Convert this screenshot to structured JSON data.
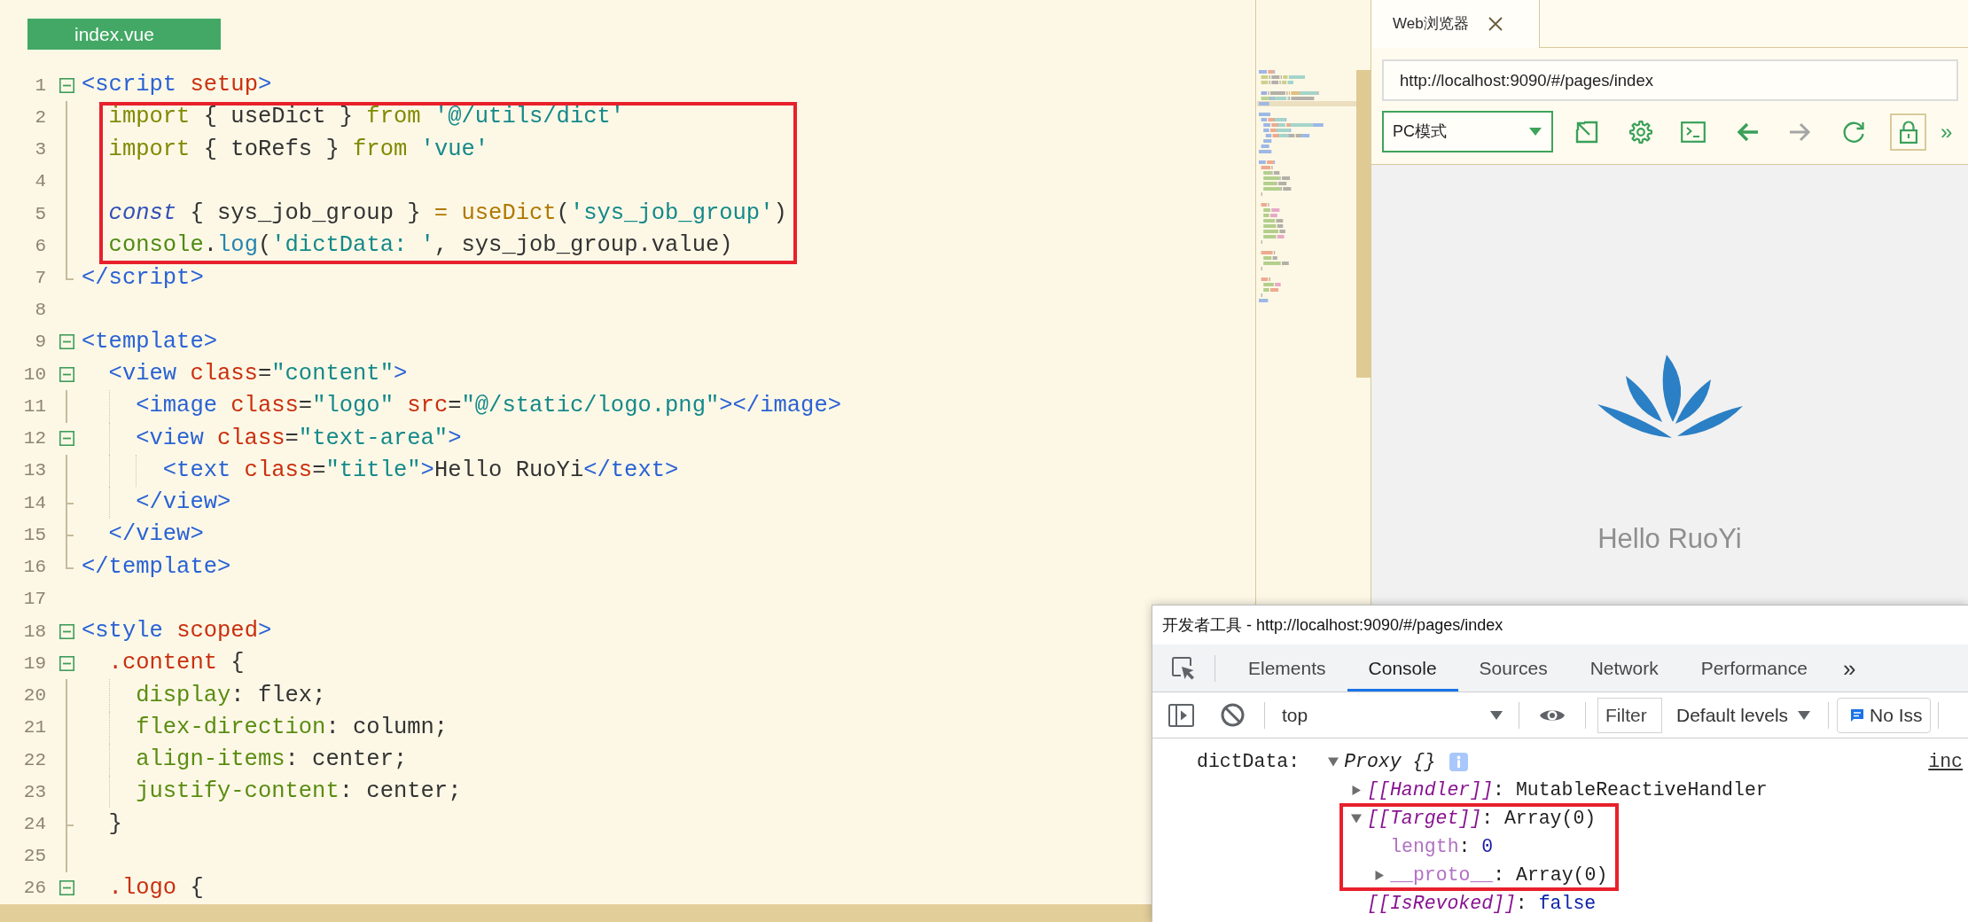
{
  "editor": {
    "tab": {
      "label": "index.vue",
      "selected": true
    },
    "lines": [
      {
        "number": "1",
        "kind": "fold",
        "boxed": false,
        "tokens": [
          {
            "text": "<script",
            "kind": "tag"
          },
          {
            "text": " setup",
            "kind": "attr"
          },
          {
            "text": ">",
            "kind": "tag"
          }
        ]
      },
      {
        "number": "2",
        "kind": "bar",
        "boxed": true,
        "tokens": [
          {
            "text": "  import",
            "kind": "keyword"
          },
          {
            "text": " { useDict } ",
            "kind": "plain"
          },
          {
            "text": "from",
            "kind": "keyword"
          },
          {
            "text": " '@/utils/dict'",
            "kind": "string"
          }
        ]
      },
      {
        "number": "3",
        "kind": "bar",
        "boxed": true,
        "tokens": [
          {
            "text": "  import",
            "kind": "keyword"
          },
          {
            "text": " { toRefs } ",
            "kind": "plain"
          },
          {
            "text": "from",
            "kind": "keyword"
          },
          {
            "text": " 'vue'",
            "kind": "string"
          }
        ]
      },
      {
        "number": "4",
        "kind": "bar",
        "boxed": true
      },
      {
        "number": "5",
        "kind": "bar",
        "boxed": true,
        "tokens": [
          {
            "text": "  const",
            "kind": "const"
          },
          {
            "text": " { sys_job_group } ",
            "kind": "plain"
          },
          {
            "text": "=",
            "kind": "operator"
          },
          {
            "text": " useDict",
            "kind": "func"
          },
          {
            "text": "(",
            "kind": "plain"
          },
          {
            "text": "'sys_job_group'",
            "kind": "string"
          },
          {
            "text": ")",
            "kind": "plain"
          }
        ]
      },
      {
        "number": "6",
        "kind": "bar",
        "boxed": true,
        "tokens": [
          {
            "text": "  console",
            "kind": "global"
          },
          {
            "text": ".",
            "kind": "plain"
          },
          {
            "text": "log",
            "kind": "method"
          },
          {
            "text": "(",
            "kind": "plain"
          },
          {
            "text": "'dictData: '",
            "kind": "string"
          },
          {
            "text": ", sys_job_group.value)",
            "kind": "plain"
          }
        ]
      },
      {
        "number": "7",
        "kind": "end",
        "boxed": false,
        "tokens": [
          {
            "text": "</script>",
            "kind": "tag"
          }
        ]
      },
      {
        "number": "8",
        "kind": "none",
        "boxed": false
      },
      {
        "number": "9",
        "kind": "fold",
        "boxed": false,
        "tokens": [
          {
            "text": "<template>",
            "kind": "tag"
          }
        ]
      },
      {
        "number": "10",
        "kind": "fold",
        "boxed": false,
        "tokens": [
          {
            "text": "  <view",
            "kind": "tag"
          },
          {
            "text": " class",
            "kind": "attr"
          },
          {
            "text": "=",
            "kind": "plain"
          },
          {
            "text": "\"content\"",
            "kind": "string"
          },
          {
            "text": ">",
            "kind": "tag"
          }
        ]
      },
      {
        "number": "11",
        "kind": "bar",
        "boxed": false,
        "tokens": [
          {
            "text": "    <image",
            "kind": "tag"
          },
          {
            "text": " class",
            "kind": "attr"
          },
          {
            "text": "=",
            "kind": "plain"
          },
          {
            "text": "\"logo\"",
            "kind": "string"
          },
          {
            "text": " src",
            "kind": "attr"
          },
          {
            "text": "=",
            "kind": "plain"
          },
          {
            "text": "\"@/static/logo.png\"",
            "kind": "string"
          },
          {
            "text": "></image>",
            "kind": "tag"
          }
        ]
      },
      {
        "number": "12",
        "kind": "fold",
        "boxed": false,
        "tokens": [
          {
            "text": "    <view",
            "kind": "tag"
          },
          {
            "text": " class",
            "kind": "attr"
          },
          {
            "text": "=",
            "kind": "plain"
          },
          {
            "text": "\"text-area\"",
            "kind": "string"
          },
          {
            "text": ">",
            "kind": "tag"
          }
        ]
      },
      {
        "number": "13",
        "kind": "bar",
        "boxed": false,
        "tokens": [
          {
            "text": "      <text",
            "kind": "tag"
          },
          {
            "text": " class",
            "kind": "attr"
          },
          {
            "text": "=",
            "kind": "plain"
          },
          {
            "text": "\"title\"",
            "kind": "string"
          },
          {
            "text": ">",
            "kind": "tag"
          },
          {
            "text": "Hello RuoYi",
            "kind": "plain"
          },
          {
            "text": "</text>",
            "kind": "tag"
          }
        ]
      },
      {
        "number": "14",
        "kind": "branch",
        "boxed": false,
        "tokens": [
          {
            "text": "    </view>",
            "kind": "tag"
          }
        ]
      },
      {
        "number": "15",
        "kind": "branch",
        "boxed": false,
        "tokens": [
          {
            "text": "  </view>",
            "kind": "tag"
          }
        ]
      },
      {
        "number": "16",
        "kind": "end",
        "boxed": false,
        "tokens": [
          {
            "text": "</template>",
            "kind": "tag"
          }
        ]
      },
      {
        "number": "17",
        "kind": "none",
        "boxed": false
      },
      {
        "number": "18",
        "kind": "fold",
        "boxed": false,
        "tokens": [
          {
            "text": "<style",
            "kind": "tag"
          },
          {
            "text": " scoped",
            "kind": "attr"
          },
          {
            "text": ">",
            "kind": "tag"
          }
        ]
      },
      {
        "number": "19",
        "kind": "fold",
        "boxed": false,
        "tokens": [
          {
            "text": "  .content",
            "kind": "attr"
          },
          {
            "text": " {",
            "kind": "plain"
          }
        ]
      },
      {
        "number": "20",
        "kind": "bar",
        "boxed": false,
        "tokens": [
          {
            "text": "    display",
            "kind": "property"
          },
          {
            "text": ": flex;",
            "kind": "plain"
          }
        ]
      },
      {
        "number": "21",
        "kind": "bar",
        "boxed": false,
        "tokens": [
          {
            "text": "    flex-direction",
            "kind": "property"
          },
          {
            "text": ": column;",
            "kind": "plain"
          }
        ]
      },
      {
        "number": "22",
        "kind": "bar",
        "boxed": false,
        "tokens": [
          {
            "text": "    align-items",
            "kind": "property"
          },
          {
            "text": ": center;",
            "kind": "plain"
          }
        ]
      },
      {
        "number": "23",
        "kind": "bar",
        "boxed": false,
        "tokens": [
          {
            "text": "    justify-content",
            "kind": "property"
          },
          {
            "text": ": center;",
            "kind": "plain"
          }
        ]
      },
      {
        "number": "24",
        "kind": "branch",
        "boxed": false,
        "tokens": [
          {
            "text": "  }",
            "kind": "plain"
          }
        ]
      },
      {
        "number": "25",
        "kind": "bar",
        "boxed": false
      },
      {
        "number": "26",
        "kind": "fold",
        "boxed": false,
        "tokens": [
          {
            "text": "  .logo",
            "kind": "attr"
          },
          {
            "text": " {",
            "kind": "plain"
          }
        ]
      }
    ]
  },
  "browser": {
    "tab": {
      "label": "Web浏览器",
      "selected": true
    },
    "address": {
      "value": "http://localhost:9090/#/pages/index"
    },
    "device_mode": {
      "value": "PC模式"
    },
    "toolbar": {
      "back": {
        "disabled": false
      },
      "forward": {
        "disabled": true
      },
      "lock": {
        "on": true
      },
      "more": "»"
    }
  },
  "preview": {
    "title": "Hello RuoYi"
  },
  "devtools": {
    "title": "开发者工具 - http://localhost:9090/#/pages/index",
    "tabs": [
      {
        "label": "Elements",
        "selected": false
      },
      {
        "label": "Console",
        "selected": true
      },
      {
        "label": "Sources",
        "selected": false
      },
      {
        "label": "Network",
        "selected": false
      },
      {
        "label": "Performance",
        "selected": false
      }
    ],
    "tabs_more": "»",
    "console_toolbar": {
      "context": "top",
      "filter": {
        "placeholder": "Filter"
      },
      "levels": "Default levels",
      "issues": "No Iss"
    },
    "messages": [
      {
        "label": "dictData:",
        "source": "inc",
        "value": {
          "kind": "branch",
          "expanded": true,
          "boxed": false,
          "tokens": [
            {
              "text": "Proxy {}",
              "kind": "italic"
            }
          ],
          "children": [
            {
              "kind": "branch",
              "expanded": false,
              "boxed": false,
              "tokens": [
                {
                  "text": "[[Handler]]",
                  "kind": "internal"
                },
                {
                  "text": ": ",
                  "kind": "plain"
                },
                {
                  "text": "MutableReactiveHandler",
                  "kind": "object"
                }
              ]
            },
            {
              "kind": "branch",
              "expanded": true,
              "boxed": true,
              "tokens": [
                {
                  "text": "[[Target]]",
                  "kind": "internal"
                },
                {
                  "text": ": ",
                  "kind": "plain"
                },
                {
                  "text": "Array(0)",
                  "kind": "object"
                }
              ],
              "children": [
                {
                  "kind": "leaf",
                  "boxed": false,
                  "tokens": [
                    {
                      "text": "length",
                      "kind": "property"
                    },
                    {
                      "text": ": ",
                      "kind": "plain"
                    },
                    {
                      "text": "0",
                      "kind": "number"
                    }
                  ]
                },
                {
                  "kind": "branch",
                  "expanded": false,
                  "boxed": false,
                  "tokens": [
                    {
                      "text": "__proto__",
                      "kind": "property"
                    },
                    {
                      "text": ": ",
                      "kind": "plain"
                    },
                    {
                      "text": "Array(0)",
                      "kind": "object"
                    }
                  ]
                }
              ]
            },
            {
              "kind": "leaf",
              "boxed": false,
              "tokens": [
                {
                  "text": "[[IsRevoked]]",
                  "kind": "internal"
                },
                {
                  "text": ": ",
                  "kind": "plain"
                },
                {
                  "text": "false",
                  "kind": "boolean"
                }
              ]
            }
          ]
        }
      }
    ]
  }
}
